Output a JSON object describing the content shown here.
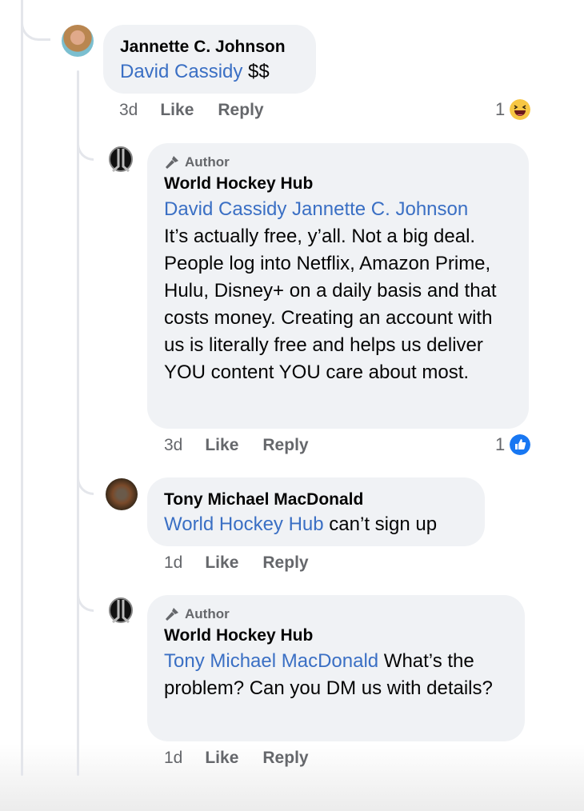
{
  "comments": [
    {
      "author": "Jannette C. Johnson",
      "mention": "David Cassidy",
      "text": " $$",
      "time": "3d",
      "like_label": "Like",
      "reply_label": "Reply",
      "reaction_count": "1",
      "reaction_type": "haha-icon"
    },
    {
      "badge": "Author",
      "author": "World Hockey Hub",
      "mention": "David Cassidy Jannette C. Johnson",
      "text": "It’s actually free, y’all. Not a big deal. People log into Netflix, Amazon Prime, Hulu, Disney+ on a daily basis and that costs money. Creating an account with us is literally free and helps us deliver YOU content YOU care about most.",
      "time": "3d",
      "like_label": "Like",
      "reply_label": "Reply",
      "reaction_count": "1",
      "reaction_type": "like-icon"
    },
    {
      "author": "Tony Michael MacDonald",
      "mention": "World Hockey Hub",
      "text": " can’t sign up",
      "time": "1d",
      "like_label": "Like",
      "reply_label": "Reply"
    },
    {
      "badge": "Author",
      "author": "World Hockey Hub",
      "mention": "Tony Michael MacDonald",
      "text": " What’s the problem? Can you DM us with details?",
      "time": "1d",
      "like_label": "Like",
      "reply_label": "Reply"
    }
  ],
  "colors": {
    "mention": "#3a6fc4",
    "bubble": "#f0f2f5",
    "like_blue": "#1877f2"
  }
}
